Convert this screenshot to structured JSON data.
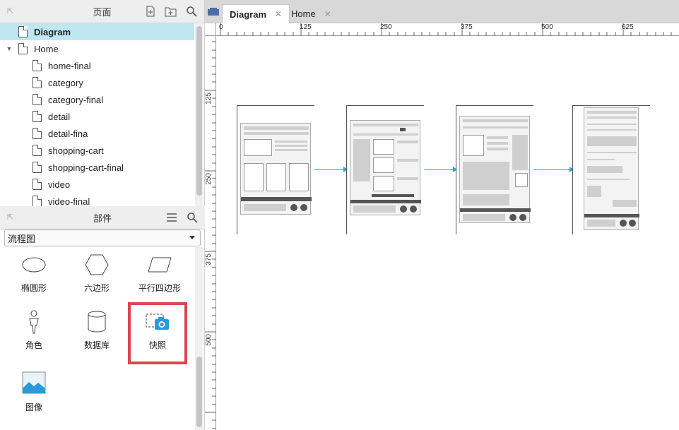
{
  "pages_panel": {
    "title": "页面",
    "items": [
      {
        "label": "Diagram",
        "level": 0,
        "selected": true
      },
      {
        "label": "Home",
        "level": 0,
        "expanded": true
      },
      {
        "label": "home-final",
        "level": 1
      },
      {
        "label": "category",
        "level": 1
      },
      {
        "label": "category-final",
        "level": 1
      },
      {
        "label": "detail",
        "level": 1
      },
      {
        "label": "detail-fina",
        "level": 1
      },
      {
        "label": "shopping-cart",
        "level": 1
      },
      {
        "label": "shopping-cart-final",
        "level": 1
      },
      {
        "label": "video",
        "level": 1
      },
      {
        "label": "video-final",
        "level": 1
      }
    ]
  },
  "widgets_panel": {
    "title": "部件",
    "library": "流程图",
    "items": [
      {
        "label": "椭圆形",
        "icon": "ellipse-icon"
      },
      {
        "label": "六边形",
        "icon": "hexagon-icon"
      },
      {
        "label": "平行四边形",
        "icon": "parallelogram-icon"
      },
      {
        "label": "角色",
        "icon": "actor-icon"
      },
      {
        "label": "数据库",
        "icon": "database-icon"
      },
      {
        "label": "快照",
        "icon": "snapshot-icon",
        "highlighted": true
      },
      {
        "label": "图像",
        "icon": "image-icon"
      }
    ]
  },
  "tabs": [
    {
      "label": "Diagram",
      "active": true
    },
    {
      "label": "Home",
      "active": false
    }
  ],
  "ruler": {
    "top": [
      "0",
      "125",
      "250",
      "375",
      "500",
      "625"
    ],
    "left": [
      "125",
      "250",
      "375",
      "500"
    ]
  },
  "colors": {
    "selection": "#bfe7f2",
    "accent": "#2aa7c9",
    "highlight_border": "#d9474f"
  }
}
